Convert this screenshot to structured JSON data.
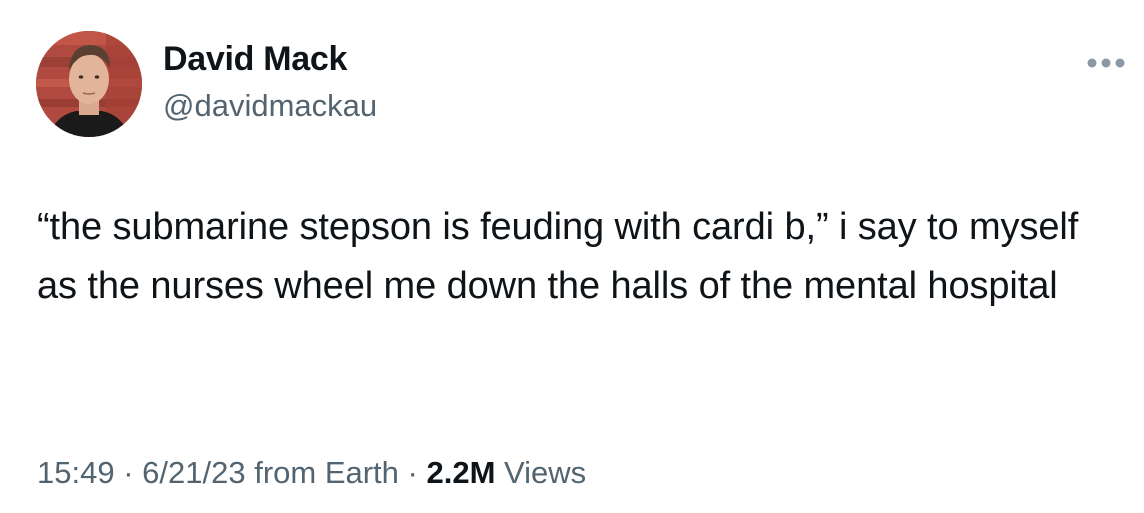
{
  "tweet": {
    "author": {
      "display_name": "David Mack",
      "handle": "@davidmackau",
      "avatar_icon": "user-avatar-photo"
    },
    "more_icon": "more-horizontal-icon",
    "text": "“the submarine stepson is feuding with cardi b,” i say to myself as the nurses wheel me down the halls of the mental hospital",
    "time": "15:49",
    "separator": " · ",
    "date": "6/21/23",
    "source": "from Earth",
    "views_count": "2.2M",
    "views_label": "Views"
  },
  "colors": {
    "text_primary": "#0f1419",
    "text_secondary": "#536471",
    "more_icon": "#8b98a5"
  }
}
